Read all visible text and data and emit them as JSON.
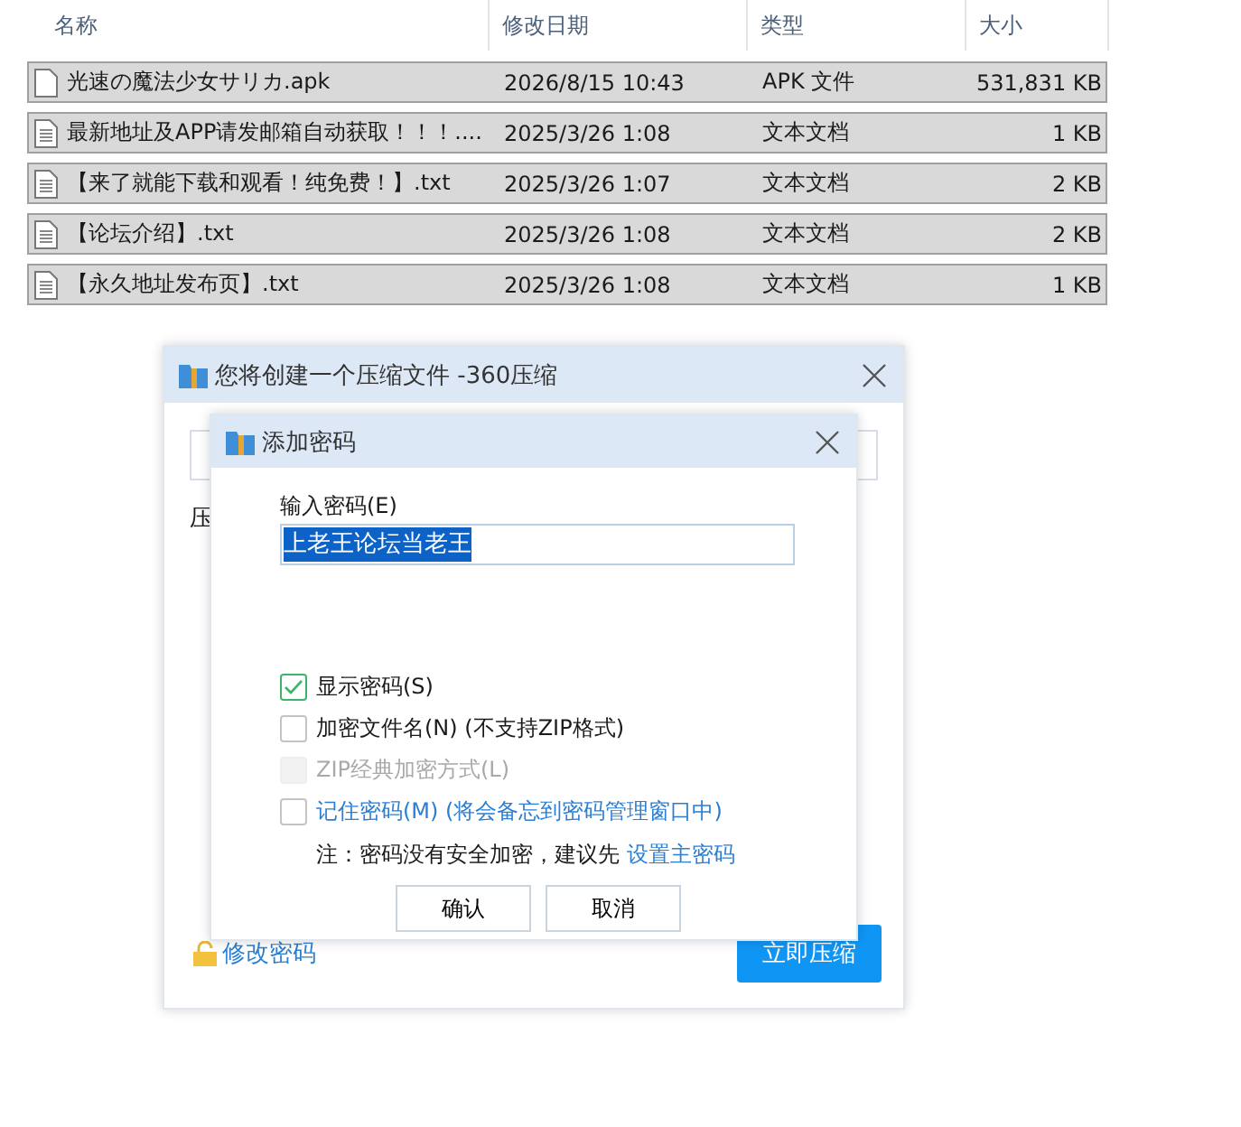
{
  "file_list": {
    "columns": [
      "名称",
      "修改日期",
      "类型",
      "大小"
    ],
    "rows": [
      {
        "name": "光速の魔法少女サリカ.apk",
        "date": "2026/8/15 10:43",
        "type": "APK 文件",
        "size": "531,831 KB",
        "kind": "apk",
        "selected": true
      },
      {
        "name": "最新地址及APP请发邮箱自动获取！！！....",
        "date": "2025/3/26 1:08",
        "type": "文本文档",
        "size": "1 KB",
        "kind": "txt",
        "selected": true
      },
      {
        "name": "【来了就能下载和观看！纯免费！】.txt",
        "date": "2025/3/26 1:07",
        "type": "文本文档",
        "size": "2 KB",
        "kind": "txt",
        "selected": true
      },
      {
        "name": "【论坛介绍】.txt",
        "date": "2025/3/26 1:08",
        "type": "文本文档",
        "size": "2 KB",
        "kind": "txt",
        "selected": true
      },
      {
        "name": "【永久地址发布页】.txt",
        "date": "2025/3/26 1:08",
        "type": "文本文档",
        "size": "1 KB",
        "kind": "txt",
        "selected": true
      }
    ]
  },
  "compress_dialog": {
    "title": "您将创建一个压缩文件 -360压缩",
    "label_fragment": "压",
    "change_password_link": "修改密码",
    "compress_button": "立即压缩"
  },
  "password_dialog": {
    "title": "添加密码",
    "input_label": "输入密码(E)",
    "password": "上老王论坛当老王",
    "options": [
      {
        "label": "显示密码(S)",
        "checked": true,
        "disabled": false,
        "kind": "plain"
      },
      {
        "label": "加密文件名(N) (不支持ZIP格式)",
        "checked": false,
        "disabled": false,
        "kind": "plain"
      },
      {
        "label": "ZIP经典加密方式(L)",
        "checked": false,
        "disabled": true,
        "kind": "plain"
      },
      {
        "label": "记住密码(M) (将会备忘到密码管理窗口中)",
        "checked": false,
        "disabled": false,
        "kind": "link"
      }
    ],
    "note": "注：密码没有安全加密，建议先",
    "note_link": "设置主密码",
    "buttons": [
      "确认",
      "取消"
    ]
  }
}
